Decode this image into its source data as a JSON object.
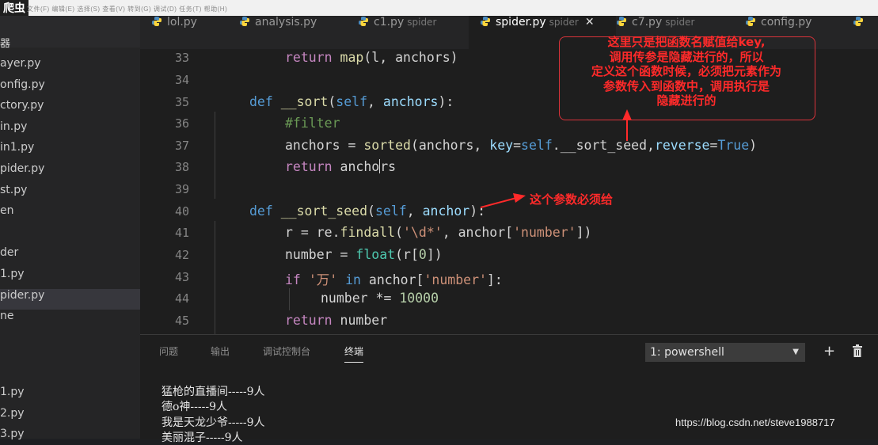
{
  "app": {
    "title": "爬虫",
    "menu_line": "文件(F)  编辑(E)  选择(S)  查看(V)  转到(G)  调试(D)  任务(T)  帮助(H)"
  },
  "sidebar": {
    "header": "器",
    "items": [
      {
        "label": "ayer.py"
      },
      {
        "label": "onfig.py"
      },
      {
        "label": "ctory.py"
      },
      {
        "label": "in.py"
      },
      {
        "label": "in1.py"
      },
      {
        "label": "pider.py"
      },
      {
        "label": "st.py"
      },
      {
        "label": "en"
      },
      {
        "label": ""
      },
      {
        "label": "der"
      },
      {
        "label": "1.py"
      },
      {
        "label": "pider.py",
        "active": true
      },
      {
        "label": "ne"
      }
    ],
    "lower_items": [
      {
        "label": "1.py"
      },
      {
        "label": "2.py"
      },
      {
        "label": "3.py"
      }
    ]
  },
  "tabs": [
    {
      "label": "lol.py",
      "sub": ""
    },
    {
      "label": "analysis.py",
      "sub": ""
    },
    {
      "label": "c1.py",
      "sub": "spider"
    },
    {
      "label": "spider.py",
      "sub": "spider",
      "active": true,
      "close": "✕"
    },
    {
      "label": "c7.py",
      "sub": "spider"
    },
    {
      "label": "config.py",
      "sub": ""
    }
  ],
  "editor": {
    "line_numbers": [
      "33",
      "34",
      "35",
      "36",
      "37",
      "38",
      "39",
      "40",
      "41",
      "42",
      "43",
      "44",
      "45"
    ]
  },
  "panel": {
    "tabs": [
      "问题",
      "输出",
      "调试控制台",
      "终端"
    ],
    "active_tab": "终端",
    "shell": "1: powershell",
    "add_label": "+",
    "terminal_lines": [
      "猛枪的直播间-----9人",
      "德o神-----9人",
      "我是天龙少爷-----9人",
      "美丽混子-----9人"
    ]
  },
  "annotations": {
    "note1": [
      "这里只是把函数名赋值给key,",
      "调用传参是隐藏进行的，所以",
      "定义这个函数时候，必须把元素作为",
      "参数传入到函数中，调用执行是",
      "隐藏进行的"
    ],
    "note2": "这个参数必须给",
    "colors": {
      "annotation": "#ff2a2a"
    }
  },
  "watermark": "https://blog.csdn.net/steve1988717"
}
